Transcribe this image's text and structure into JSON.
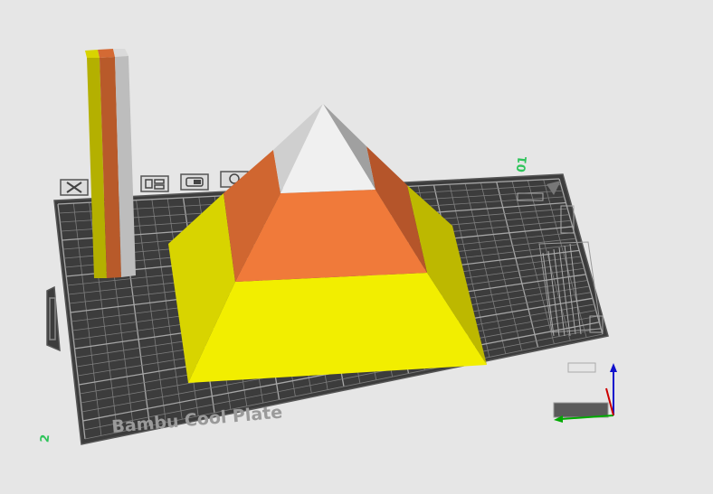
{
  "plate": {
    "label": "Bambu Cool Plate",
    "plate_number": "01",
    "corner_mark": "2"
  },
  "toolbar_icons": [
    {
      "name": "close-plate-icon"
    },
    {
      "name": "arrange-plate-icon"
    },
    {
      "name": "lock-plate-icon"
    },
    {
      "name": "settings-plate-icon"
    }
  ],
  "objects": [
    {
      "name": "candy-corn-pyramid",
      "colors": [
        "#f2ee00",
        "#f07a3a",
        "#f0f0f0"
      ]
    },
    {
      "name": "color-test-bar",
      "colors": [
        "#c8c000",
        "#c0622e",
        "#c8c8c8"
      ]
    }
  ],
  "colors": {
    "background": "#e6e6e6",
    "plate": "#3c3c3c",
    "grid": "#8c8c8c",
    "label": "#9a9a9a",
    "axis_x": "#cc0000",
    "axis_y": "#00aa00",
    "axis_z": "#1010cc",
    "plate_number": "#2ec45a"
  }
}
